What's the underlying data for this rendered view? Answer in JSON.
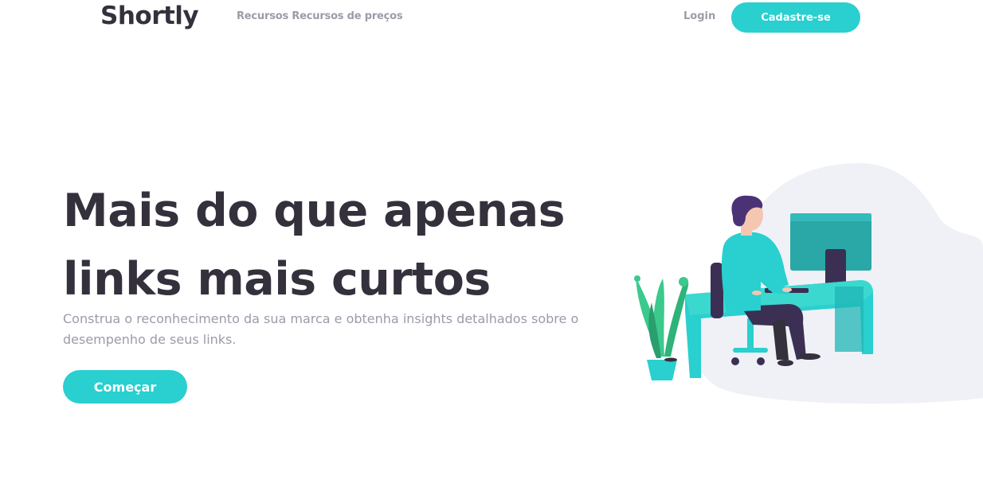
{
  "header": {
    "logo": "Shortly",
    "nav_links": "Recursos Recursos de preços",
    "login": "Login",
    "signup": "Cadastre-se"
  },
  "hero": {
    "title_line1": "Mais do que apenas",
    "title_line2": "links mais curtos",
    "subtitle": "Construa o reconhecimento da sua marca e obtenha insights detalhados sobre o desempenho de seus links.",
    "cta": "Começar"
  },
  "illustration": {
    "icon": "person-working-illustration"
  },
  "colors": {
    "accent": "#2acfcf",
    "dark_text": "#34313d",
    "gray_text": "#9e9aa8",
    "blob": "#eff1f7"
  }
}
